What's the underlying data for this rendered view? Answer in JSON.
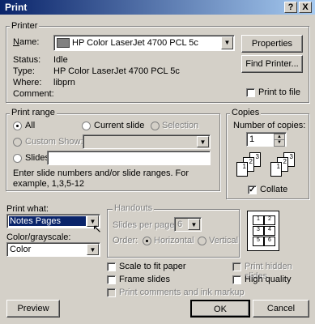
{
  "title": "Print",
  "title_buttons": {
    "help": "?",
    "close": "X"
  },
  "printer": {
    "group": "Printer",
    "name_label": "Name:",
    "name_value": "HP Color LaserJet 4700 PCL 5c",
    "status_label": "Status:",
    "status_value": "Idle",
    "type_label": "Type:",
    "type_value": "HP Color LaserJet 4700 PCL 5c",
    "where_label": "Where:",
    "where_value": "libprn",
    "comment_label": "Comment:",
    "properties": "Properties",
    "find_printer": "Find Printer...",
    "print_to_file": "Print to file"
  },
  "range": {
    "group": "Print range",
    "all": "All",
    "current_slide": "Current slide",
    "selection": "Selection",
    "custom_show": "Custom Show:",
    "slides": "Slides:",
    "hint": "Enter slide numbers and/or slide ranges. For example, 1,3,5-12"
  },
  "copies": {
    "group": "Copies",
    "number_label": "Number of copies:",
    "number_value": "1",
    "collate": "Collate"
  },
  "print_what": {
    "label": "Print what:",
    "value": "Notes Pages"
  },
  "color": {
    "label": "Color/grayscale:",
    "value": "Color"
  },
  "handouts": {
    "group": "Handouts",
    "slides_per_page": "Slides per page:",
    "spp_value": "6",
    "order": "Order:",
    "horizontal": "Horizontal",
    "vertical": "Vertical",
    "preview_nums": [
      "1",
      "2",
      "3",
      "4",
      "5",
      "6"
    ]
  },
  "options": {
    "scale": "Scale to fit paper",
    "frame": "Frame slides",
    "comments": "Print comments and ink markup",
    "hidden": "Print hidden slides",
    "high_quality": "High quality"
  },
  "buttons": {
    "preview": "Preview",
    "ok": "OK",
    "cancel": "Cancel"
  }
}
